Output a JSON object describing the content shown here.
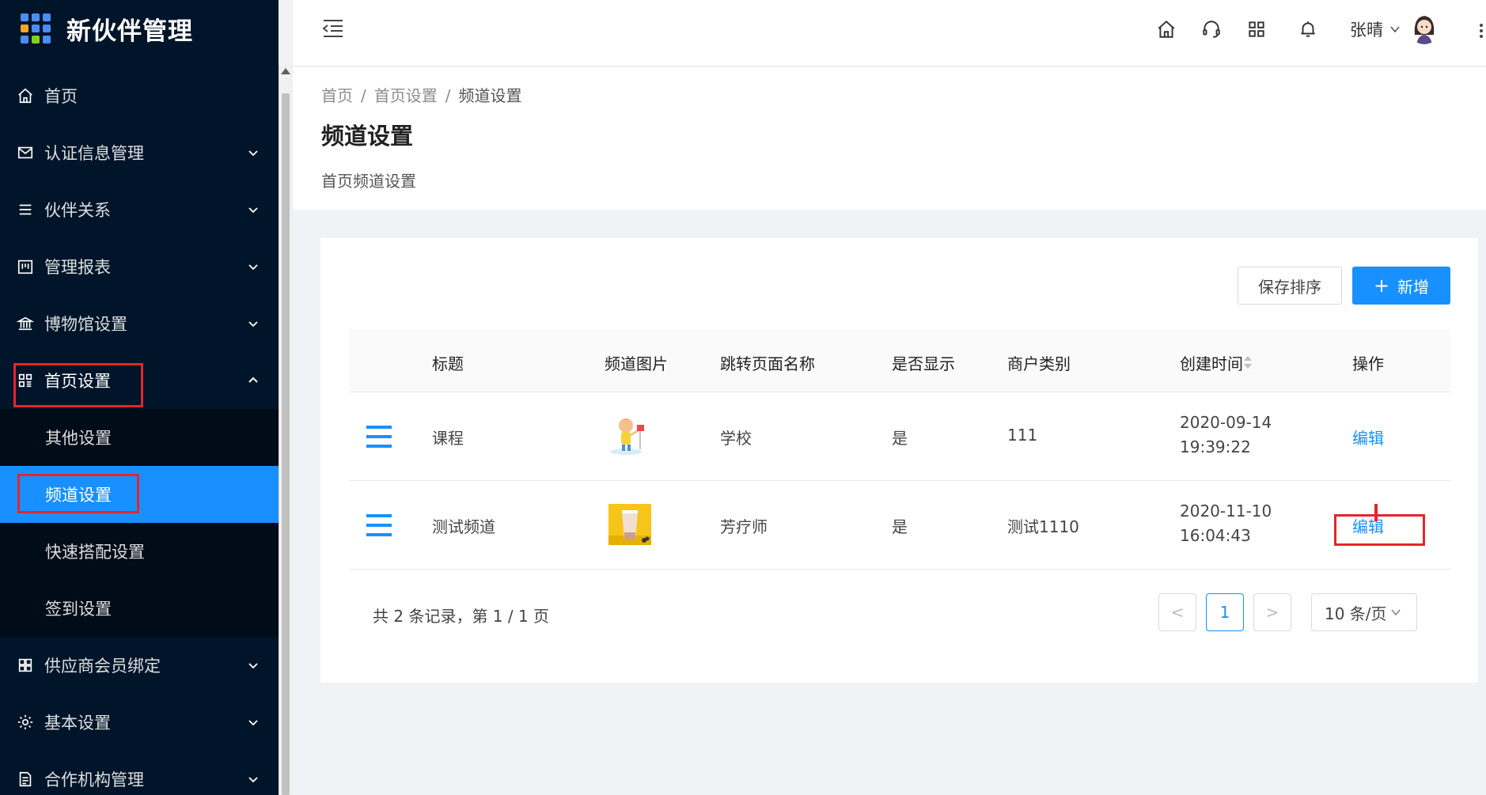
{
  "app": {
    "title": "新伙伴管理"
  },
  "colors": {
    "sidebar": "#001529",
    "submenu": "#000c17",
    "primary": "#1890ff",
    "highlight": "#e4262c"
  },
  "sidebar": {
    "items": [
      {
        "label": "首页",
        "icon": "home-icon"
      },
      {
        "label": "认证信息管理",
        "icon": "mail-icon"
      },
      {
        "label": "伙伴关系",
        "icon": "list-icon"
      },
      {
        "label": "管理报表",
        "icon": "report-icon"
      },
      {
        "label": "博物馆设置",
        "icon": "bank-icon"
      },
      {
        "label": "首页设置",
        "icon": "appstore-icon"
      },
      {
        "label": "供应商会员绑定",
        "icon": "grid-icon"
      },
      {
        "label": "基本设置",
        "icon": "gear-icon"
      },
      {
        "label": "合作机构管理",
        "icon": "file-icon"
      }
    ],
    "submenu": [
      {
        "label": "其他设置"
      },
      {
        "label": "频道设置"
      },
      {
        "label": "快速搭配设置"
      },
      {
        "label": "签到设置"
      }
    ]
  },
  "header": {
    "user_name": "张晴"
  },
  "breadcrumb": [
    "首页",
    "首页设置",
    "频道设置"
  ],
  "page": {
    "title": "频道设置",
    "description": "首页频道设置"
  },
  "toolbar": {
    "save_sort_label": "保存排序",
    "add_label": "新增",
    "add_symbol": "+"
  },
  "table": {
    "columns": [
      "标题",
      "频道图片",
      "跳转页面名称",
      "是否显示",
      "商户类别",
      "创建时间",
      "操作"
    ],
    "rows": [
      {
        "title": "课程",
        "page_name": "学校",
        "visible": "是",
        "merchant": "111",
        "date": "2020-09-14",
        "time": "19:39:22",
        "action": "编辑"
      },
      {
        "title": "测试频道",
        "page_name": "芳疗师",
        "visible": "是",
        "merchant": "测试1110",
        "date": "2020-11-10",
        "time": "16:04:43",
        "action": "编辑"
      }
    ]
  },
  "pagination": {
    "info": "共 2 条记录，第 1 / 1 页",
    "current": "1",
    "page_size": "10 条/页",
    "prev": "<",
    "next": ">"
  }
}
